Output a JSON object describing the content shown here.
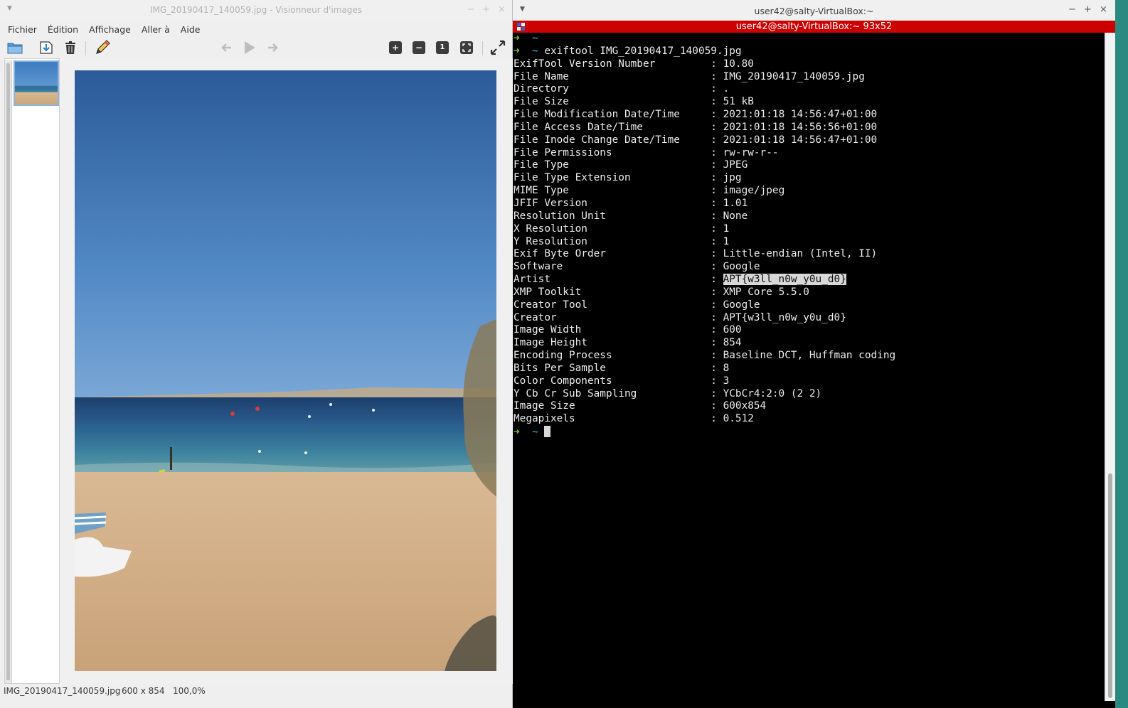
{
  "viewer": {
    "title": "IMG_20190417_140059.jpg - Visionneur d'images",
    "menu": [
      "Fichier",
      "Édition",
      "Affichage",
      "Aller à",
      "Aide"
    ],
    "toolbar": {
      "normal_size_label": "1"
    },
    "status": {
      "filename": "IMG_20190417_140059.jpg",
      "dimensions": "600 x 854",
      "zoom": "100,0%"
    }
  },
  "terminal": {
    "window_title": "user42@salty-VirtualBox:~",
    "tab_title": "user42@salty-VirtualBox:~ 93x52",
    "prompt_arrow": "➜",
    "prompt_dir": "~",
    "command": "exiftool IMG_20190417_140059.jpg",
    "exif": [
      {
        "key": "ExifTool Version Number",
        "value": "10.80"
      },
      {
        "key": "File Name",
        "value": "IMG_20190417_140059.jpg"
      },
      {
        "key": "Directory",
        "value": "."
      },
      {
        "key": "File Size",
        "value": "51 kB"
      },
      {
        "key": "File Modification Date/Time",
        "value": "2021:01:18 14:56:47+01:00"
      },
      {
        "key": "File Access Date/Time",
        "value": "2021:01:18 14:56:56+01:00"
      },
      {
        "key": "File Inode Change Date/Time",
        "value": "2021:01:18 14:56:47+01:00"
      },
      {
        "key": "File Permissions",
        "value": "rw-rw-r--"
      },
      {
        "key": "File Type",
        "value": "JPEG"
      },
      {
        "key": "File Type Extension",
        "value": "jpg"
      },
      {
        "key": "MIME Type",
        "value": "image/jpeg"
      },
      {
        "key": "JFIF Version",
        "value": "1.01"
      },
      {
        "key": "Resolution Unit",
        "value": "None"
      },
      {
        "key": "X Resolution",
        "value": "1"
      },
      {
        "key": "Y Resolution",
        "value": "1"
      },
      {
        "key": "Exif Byte Order",
        "value": "Little-endian (Intel, II)"
      },
      {
        "key": "Software",
        "value": "Google"
      },
      {
        "key": "Artist",
        "value": "APT{w3ll_n0w_y0u_d0}",
        "highlighted": true
      },
      {
        "key": "XMP Toolkit",
        "value": "XMP Core 5.5.0"
      },
      {
        "key": "Creator Tool",
        "value": "Google"
      },
      {
        "key": "Creator",
        "value": "APT{w3ll_n0w_y0u_d0}"
      },
      {
        "key": "Image Width",
        "value": "600"
      },
      {
        "key": "Image Height",
        "value": "854"
      },
      {
        "key": "Encoding Process",
        "value": "Baseline DCT, Huffman coding"
      },
      {
        "key": "Bits Per Sample",
        "value": "8"
      },
      {
        "key": "Color Components",
        "value": "3"
      },
      {
        "key": "Y Cb Cr Sub Sampling",
        "value": "YCbCr4:2:0 (2 2)"
      },
      {
        "key": "Image Size",
        "value": "600x854"
      },
      {
        "key": "Megapixels",
        "value": "0.512"
      }
    ]
  },
  "colors": {
    "terminal_tab": "#cc0000",
    "prompt_arrow": "#7ed321",
    "prompt_dir": "#3fc0e0",
    "terminal_bg": "#000000",
    "terminal_fg": "#ebebeb"
  },
  "icons": [
    "open-folder-icon",
    "save-icon",
    "trash-icon",
    "edit-pencil-icon",
    "back-arrow-icon",
    "play-icon",
    "forward-arrow-icon",
    "zoom-in-icon",
    "zoom-out-icon",
    "normal-size-icon",
    "fit-window-icon",
    "fullscreen-icon"
  ]
}
